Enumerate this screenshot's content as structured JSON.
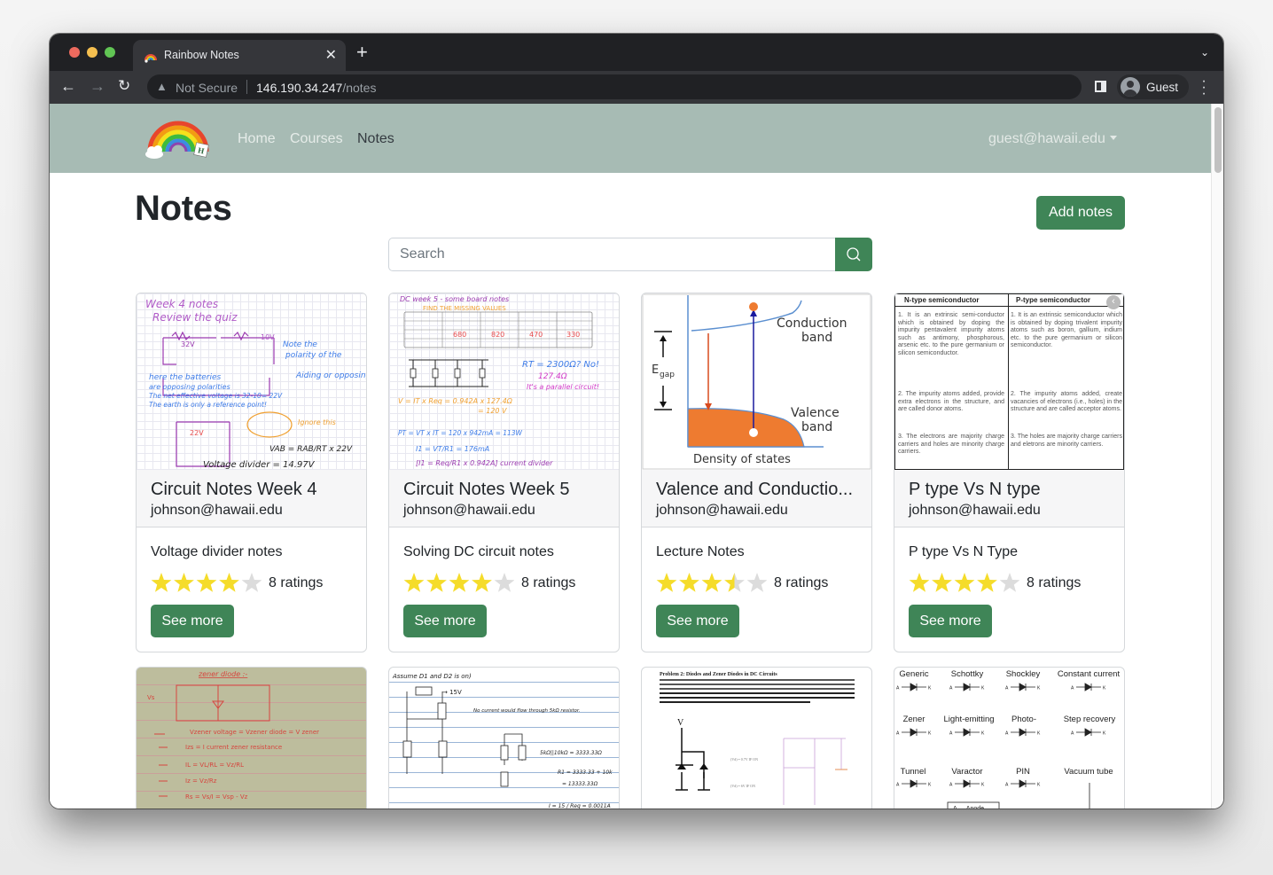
{
  "browser": {
    "tab_title": "Rainbow Notes",
    "security_label": "Not Secure",
    "url_host": "146.190.34.247",
    "url_path": "/notes",
    "profile_label": "Guest"
  },
  "navbar": {
    "links": [
      {
        "label": "Home",
        "active": false
      },
      {
        "label": "Courses",
        "active": false
      },
      {
        "label": "Notes",
        "active": true
      }
    ],
    "user_email": "guest@hawaii.edu"
  },
  "page": {
    "title": "Notes",
    "add_button": "Add notes",
    "search_placeholder": "Search",
    "search_value": ""
  },
  "colors": {
    "accent": "#3f8557",
    "navbar_bg": "#a7bbb4",
    "star_filled": "#f5dc2a",
    "star_empty": "#dcdcdc"
  },
  "cards": [
    {
      "title": "Circuit Notes Week 4",
      "owner": "johnson@hawaii.edu",
      "description": "Voltage divider notes",
      "rating": 4,
      "rating_count": "8 ratings",
      "button": "See more",
      "thumbnail": "Handwritten voltage divider notes on grid paper"
    },
    {
      "title": "Circuit Notes Week 5",
      "owner": "johnson@hawaii.edu",
      "description": "Solving DC circuit notes",
      "rating": 4,
      "rating_count": "8 ratings",
      "button": "See more",
      "thumbnail": "DC week 5 board notes table and parallel resistors"
    },
    {
      "title": "Valence and Conductio...",
      "owner": "johnson@hawaii.edu",
      "description": "Lecture Notes",
      "rating": 3.5,
      "rating_count": "8 ratings",
      "button": "See more",
      "thumbnail": "Band diagram: Conduction band, Valence band, Egap, Density of states"
    },
    {
      "title": "P type Vs N type",
      "owner": "johnson@hawaii.edu",
      "description": "P type Vs N Type",
      "rating": 4,
      "rating_count": "8 ratings",
      "button": "See more",
      "thumbnail": "N-type vs P-type semiconductor comparison table"
    }
  ],
  "thumbs": {
    "band": {
      "conduction": [
        "Conduction",
        "band"
      ],
      "valence": [
        "Valence",
        "band"
      ],
      "egap": "E",
      "egap_sub": "gap",
      "axis": "Density of states"
    },
    "semi": {
      "headers": [
        "N-type semiconductor",
        "P-type semiconductor"
      ],
      "n_rows": [
        "1. It is an extrinsic semi-conductor which is obtained by doping the impurity pentavalent impurity atoms such as antimony, phosphorous, arsenic etc. to the pure germanium or silicon semiconductor.",
        "2. The impurity atoms added, provide extra electrons in the structure, and are called donor atoms.",
        "3. The electrons are majority charge carriers and holes are minority charge carriers."
      ],
      "p_rows": [
        "1. It is an extrinsic semiconductor which is obtained by doping trivalent impurity atoms such as boron, gallium, indium etc. to the pure germanium or silicon semiconductor.",
        "2. The impurity atoms added, create vacancies of electrons (i.e., holes) in the structure and are called acceptor atoms.",
        "3. The holes are majority charge carriers and eletrons are minority carriers."
      ]
    },
    "week4": {
      "l1": "Week 4 notes",
      "l2": "Review the quiz",
      "l3": "here the batteries",
      "l4": "are opposing polarities",
      "l5": "The net effective voltage is 32-10= 22V",
      "l6": "The earth is only a reference point!",
      "l7": "Voltage divider = 14.97V"
    },
    "week5": {
      "l1": "DC week 5 - some board notes",
      "l2": "FIND THE MISSING VALUES",
      "l3": "RT = 2300Ω? No!",
      "l4": "127.4Ω",
      "l5": "It's a parallel circuit!",
      "l6": "V = IT x Req = 0.942A x 127.4Ω",
      "l7": "= 120 V",
      "l8": "PT = VT x IT = 120 x 942mA = 113W"
    },
    "problem": {
      "title": "Problem 2: Diodes and Zener Diodes in DC Circuits"
    },
    "diodes": {
      "labels": [
        "Generic",
        "Schottky",
        "Shockley",
        "Constant current",
        "Zener",
        "Light-emitting",
        "Photo-",
        "Step recovery",
        "Tunnel",
        "Varactor",
        "PIN",
        "Vacuum tube"
      ],
      "legend": "A — Anode"
    },
    "zener": {
      "title": "zener diode :-"
    },
    "assume": {
      "title": "Assume D1 and D2 is on)",
      "note": "No current would flow through 5kΩ resistor."
    }
  }
}
